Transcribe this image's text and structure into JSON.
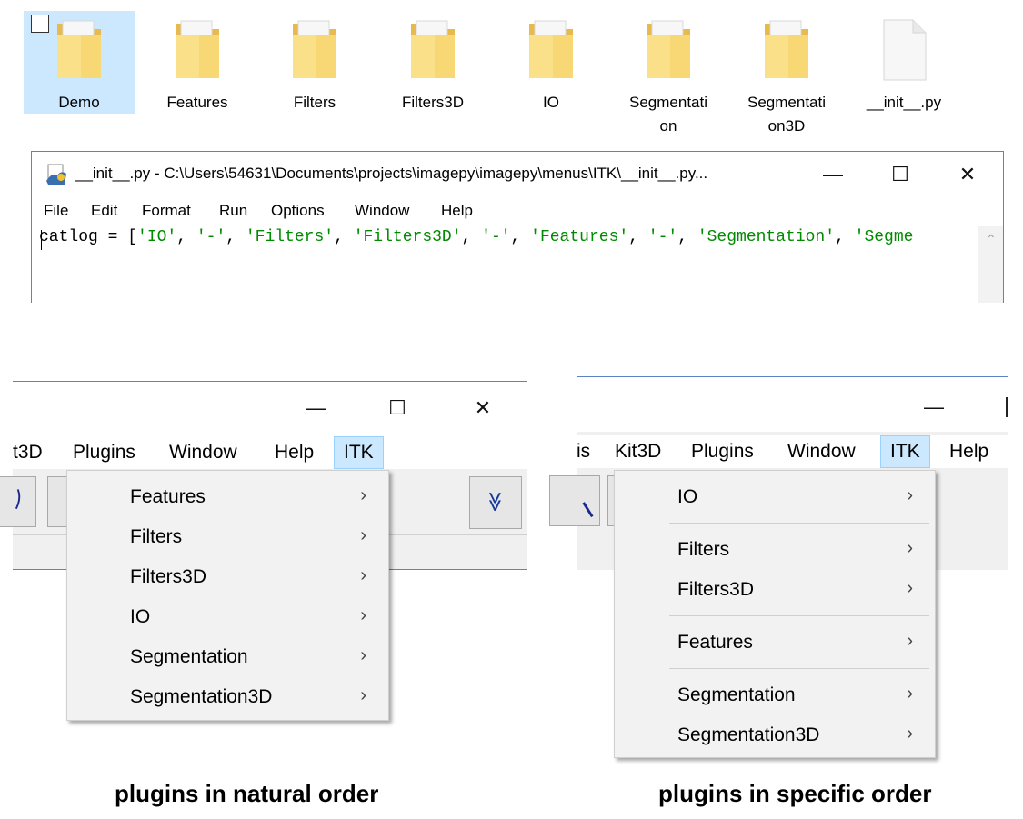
{
  "explorer": {
    "items": [
      {
        "label": "Demo",
        "type": "folder"
      },
      {
        "label": "Features",
        "type": "folder"
      },
      {
        "label": "Filters",
        "type": "folder"
      },
      {
        "label": "Filters3D",
        "type": "folder"
      },
      {
        "label": "IO",
        "type": "folder"
      },
      {
        "label": "Segmentati\non",
        "type": "folder"
      },
      {
        "label": "Segmentati\non3D",
        "type": "folder"
      },
      {
        "label": "__init__.py",
        "type": "file"
      }
    ]
  },
  "editor": {
    "title": "__init__.py - C:\\Users\\54631\\Documents\\projects\\imagepy\\imagepy\\menus\\ITK\\__init__.py...",
    "menu": [
      "File",
      "Edit",
      "Format",
      "Run",
      "Options",
      "Window",
      "Help"
    ],
    "code": {
      "prefix": "catlog = [",
      "items": [
        "'IO'",
        "'-'",
        "'Filters'",
        "'Filters3D'",
        "'-'",
        "'Features'",
        "'-'",
        "'Segmentation'",
        "'Segme"
      ]
    }
  },
  "left_app": {
    "menubar": [
      "t3D",
      "Plugins",
      "Window",
      "Help",
      "ITK"
    ],
    "dropdown": [
      "Features",
      "Filters",
      "Filters3D",
      "IO",
      "Segmentation",
      "Segmentation3D"
    ],
    "caption": "plugins in natural order"
  },
  "right_app": {
    "menubar": [
      "is",
      "Kit3D",
      "Plugins",
      "Window",
      "ITK",
      "Help"
    ],
    "dropdown_groups": [
      [
        "IO"
      ],
      [
        "Filters",
        "Filters3D"
      ],
      [
        "Features"
      ],
      [
        "Segmentation",
        "Segmentation3D"
      ]
    ],
    "caption": "plugins in specific order"
  },
  "icons": {
    "minimize": "—",
    "maximize": "☐",
    "close": "✕",
    "chevron": "›",
    "scroll_up": "⌃",
    "double_chevron": "≫"
  },
  "colors": {
    "selection": "#cce8ff",
    "string": "#008a00",
    "window_border": "#5b84c4",
    "folder": "#f3cf6b"
  }
}
